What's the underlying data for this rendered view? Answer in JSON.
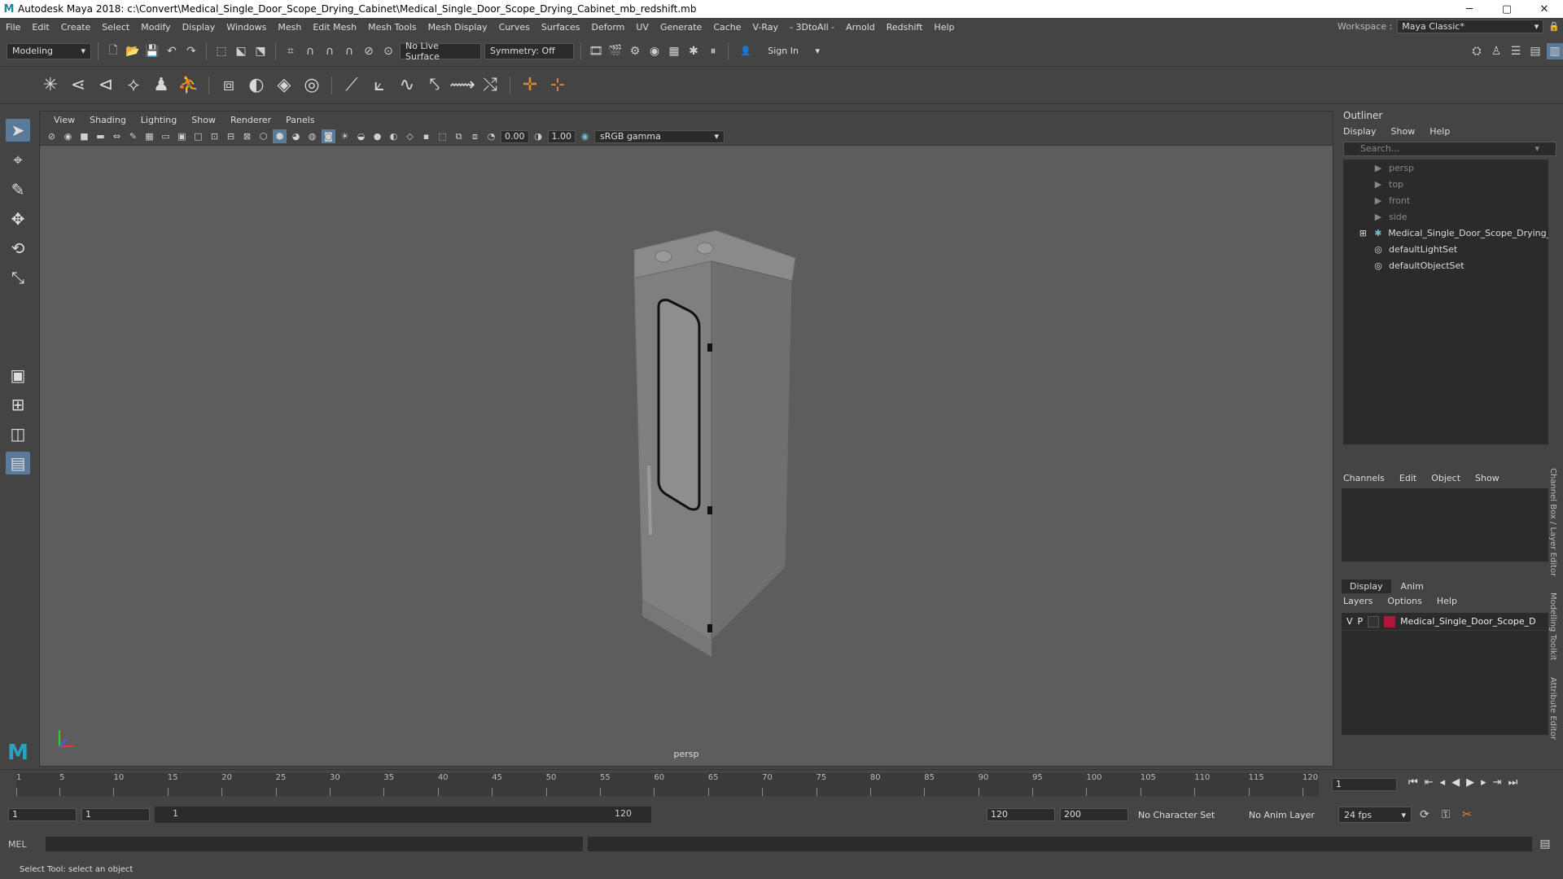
{
  "window": {
    "title": "Autodesk Maya 2018: c:\\Convert\\Medical_Single_Door_Scope_Drying_Cabinet\\Medical_Single_Door_Scope_Drying_Cabinet_mb_redshift.mb"
  },
  "menus": [
    "File",
    "Edit",
    "Create",
    "Select",
    "Modify",
    "Display",
    "Windows",
    "Mesh",
    "Edit Mesh",
    "Mesh Tools",
    "Mesh Display",
    "Curves",
    "Surfaces",
    "Deform",
    "UV",
    "Generate",
    "Cache",
    "V-Ray",
    "- 3DtoAll -",
    "Arnold",
    "Redshift",
    "Help"
  ],
  "workspace": {
    "label": "Workspace :",
    "value": "Maya Classic*"
  },
  "statusline": {
    "mode": "Modeling",
    "live_surface": "No Live Surface",
    "symmetry": "Symmetry: Off",
    "sign_in": "Sign In"
  },
  "viewport": {
    "menus": [
      "View",
      "Shading",
      "Lighting",
      "Show",
      "Renderer",
      "Panels"
    ],
    "exposure": "0.00",
    "gamma": "1.00",
    "colorspace": "sRGB gamma",
    "camera_label": "persp"
  },
  "outliner": {
    "title": "Outliner",
    "menus": [
      "Display",
      "Show",
      "Help"
    ],
    "search_placeholder": "Search...",
    "items": [
      {
        "label": "persp",
        "dim": true
      },
      {
        "label": "top",
        "dim": true
      },
      {
        "label": "front",
        "dim": true
      },
      {
        "label": "side",
        "dim": true
      },
      {
        "label": "Medical_Single_Door_Scope_Drying_Cat",
        "dim": false
      },
      {
        "label": "defaultLightSet",
        "dim": false
      },
      {
        "label": "defaultObjectSet",
        "dim": false
      }
    ]
  },
  "channelbox": {
    "menus": [
      "Channels",
      "Edit",
      "Object",
      "Show"
    ]
  },
  "layers": {
    "tabs": [
      "Display",
      "Anim"
    ],
    "menus": [
      "Layers",
      "Options",
      "Help"
    ],
    "row": {
      "v": "V",
      "p": "P",
      "name": "Medical_Single_Door_Scope_D",
      "color": "#b0163a"
    }
  },
  "side_tabs": [
    "Channel Box / Layer Editor",
    "Modelling Toolkit",
    "Attribute Editor"
  ],
  "timeline": {
    "ticks": [
      "1",
      "5",
      "10",
      "15",
      "20",
      "25",
      "30",
      "35",
      "40",
      "45",
      "50",
      "55",
      "60",
      "65",
      "70",
      "75",
      "80",
      "85",
      "90",
      "95",
      "100",
      "105",
      "110",
      "115",
      "120"
    ],
    "current_frame": "1"
  },
  "range": {
    "start": "1",
    "start2": "1",
    "slider_start": "1",
    "slider_end": "120",
    "end": "120",
    "end2": "200",
    "character_set": "No Character Set",
    "anim_layer": "No Anim Layer",
    "fps": "24 fps"
  },
  "mel": {
    "label": "MEL"
  },
  "help": {
    "text": "Select Tool: select an object"
  }
}
